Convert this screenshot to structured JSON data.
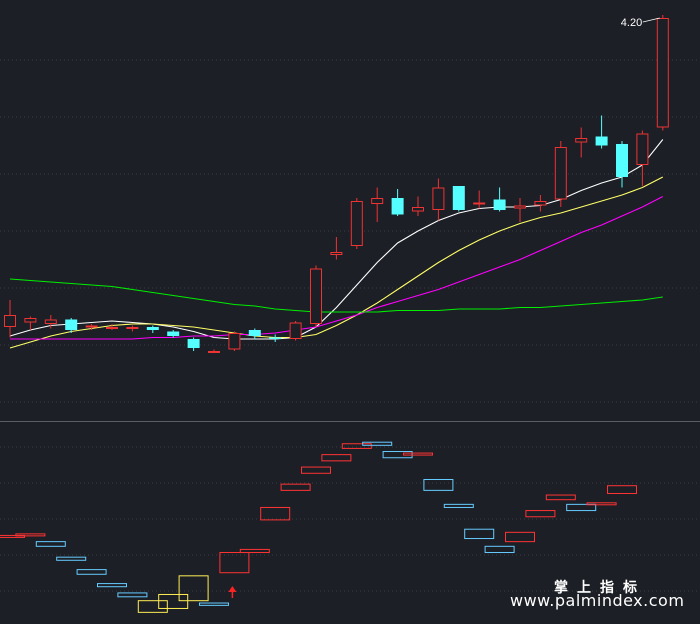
{
  "chart_data": {
    "type": "candlestick",
    "max_price_label": "4.20",
    "price_ylim": [
      1.5,
      4.3
    ],
    "candles": [
      {
        "o": 2.12,
        "h": 2.3,
        "l": 2.05,
        "c": 2.2
      },
      {
        "o": 2.15,
        "h": 2.19,
        "l": 2.1,
        "c": 2.18
      },
      {
        "o": 2.14,
        "h": 2.2,
        "l": 2.11,
        "c": 2.17
      },
      {
        "o": 2.17,
        "h": 2.18,
        "l": 2.08,
        "c": 2.1
      },
      {
        "o": 2.12,
        "h": 2.14,
        "l": 2.1,
        "c": 2.13
      },
      {
        "o": 2.12,
        "h": 2.14,
        "l": 2.1,
        "c": 2.12
      },
      {
        "o": 2.11,
        "h": 2.13,
        "l": 2.09,
        "c": 2.12
      },
      {
        "o": 2.12,
        "h": 2.13,
        "l": 2.08,
        "c": 2.1
      },
      {
        "o": 2.09,
        "h": 2.1,
        "l": 2.05,
        "c": 2.06
      },
      {
        "o": 2.04,
        "h": 2.05,
        "l": 1.96,
        "c": 1.98
      },
      {
        "o": 1.96,
        "h": 1.97,
        "l": 1.95,
        "c": 1.96
      },
      {
        "o": 1.97,
        "h": 2.09,
        "l": 1.96,
        "c": 2.08
      },
      {
        "o": 2.1,
        "h": 2.11,
        "l": 2.04,
        "c": 2.06
      },
      {
        "o": 2.05,
        "h": 2.07,
        "l": 2.02,
        "c": 2.04
      },
      {
        "o": 2.04,
        "h": 2.16,
        "l": 2.03,
        "c": 2.15
      },
      {
        "o": 2.14,
        "h": 2.53,
        "l": 2.12,
        "c": 2.51
      },
      {
        "o": 2.6,
        "h": 2.72,
        "l": 2.57,
        "c": 2.62
      },
      {
        "o": 2.66,
        "h": 2.98,
        "l": 2.64,
        "c": 2.96
      },
      {
        "o": 2.94,
        "h": 3.05,
        "l": 2.82,
        "c": 2.98
      },
      {
        "o": 2.98,
        "h": 3.04,
        "l": 2.86,
        "c": 2.87
      },
      {
        "o": 2.89,
        "h": 2.99,
        "l": 2.86,
        "c": 2.92
      },
      {
        "o": 2.9,
        "h": 3.11,
        "l": 2.83,
        "c": 3.05
      },
      {
        "o": 3.06,
        "h": 3.06,
        "l": 2.89,
        "c": 2.9
      },
      {
        "o": 2.94,
        "h": 3.03,
        "l": 2.91,
        "c": 2.95
      },
      {
        "o": 2.97,
        "h": 3.05,
        "l": 2.89,
        "c": 2.9
      },
      {
        "o": 2.91,
        "h": 2.98,
        "l": 2.82,
        "c": 2.93
      },
      {
        "o": 2.93,
        "h": 3.0,
        "l": 2.89,
        "c": 2.96
      },
      {
        "o": 2.97,
        "h": 3.36,
        "l": 2.92,
        "c": 3.32
      },
      {
        "o": 3.35,
        "h": 3.45,
        "l": 3.25,
        "c": 3.38
      },
      {
        "o": 3.39,
        "h": 3.53,
        "l": 3.31,
        "c": 3.33
      },
      {
        "o": 3.34,
        "h": 3.36,
        "l": 3.05,
        "c": 3.12
      },
      {
        "o": 3.2,
        "h": 3.43,
        "l": 3.06,
        "c": 3.41
      },
      {
        "o": 3.45,
        "h": 4.2,
        "l": 3.43,
        "c": 4.18
      }
    ],
    "ma_series": [
      {
        "color": "#ffffff",
        "values": [
          2.06,
          2.1,
          2.13,
          2.14,
          2.15,
          2.16,
          2.15,
          2.14,
          2.12,
          2.09,
          2.05,
          2.04,
          2.04,
          2.04,
          2.05,
          2.12,
          2.25,
          2.4,
          2.55,
          2.68,
          2.76,
          2.83,
          2.88,
          2.91,
          2.92,
          2.92,
          2.93,
          2.97,
          3.03,
          3.08,
          3.12,
          3.2,
          3.37
        ]
      },
      {
        "color": "#ffff66",
        "values": [
          1.98,
          2.02,
          2.06,
          2.09,
          2.11,
          2.13,
          2.14,
          2.14,
          2.13,
          2.12,
          2.1,
          2.08,
          2.06,
          2.05,
          2.05,
          2.07,
          2.13,
          2.2,
          2.28,
          2.37,
          2.46,
          2.55,
          2.63,
          2.7,
          2.76,
          2.81,
          2.85,
          2.88,
          2.92,
          2.96,
          3.0,
          3.05,
          3.12
        ]
      },
      {
        "color": "#ff00ff",
        "values": [
          2.04,
          2.04,
          2.04,
          2.04,
          2.04,
          2.04,
          2.04,
          2.05,
          2.05,
          2.06,
          2.06,
          2.07,
          2.07,
          2.08,
          2.1,
          2.12,
          2.16,
          2.2,
          2.25,
          2.29,
          2.33,
          2.37,
          2.42,
          2.47,
          2.52,
          2.57,
          2.63,
          2.69,
          2.75,
          2.8,
          2.86,
          2.92,
          2.99
        ]
      },
      {
        "color": "#00ee00",
        "values": [
          2.44,
          2.43,
          2.42,
          2.41,
          2.4,
          2.39,
          2.37,
          2.35,
          2.33,
          2.31,
          2.29,
          2.27,
          2.26,
          2.24,
          2.23,
          2.22,
          2.22,
          2.22,
          2.22,
          2.23,
          2.23,
          2.23,
          2.24,
          2.24,
          2.24,
          2.25,
          2.25,
          2.26,
          2.27,
          2.28,
          2.29,
          2.3,
          2.32
        ]
      }
    ],
    "indicator_bricks": [
      {
        "lo": 1.72,
        "hi": 1.74,
        "color": "#ff3333"
      },
      {
        "lo": 1.75,
        "hi": 1.76,
        "color": "#ff3333"
      },
      {
        "lo": 1.6,
        "hi": 1.66,
        "color": "#66ccff"
      },
      {
        "lo": 1.42,
        "hi": 1.46,
        "color": "#66ccff"
      },
      {
        "lo": 1.24,
        "hi": 1.3,
        "color": "#66ccff"
      },
      {
        "lo": 1.08,
        "hi": 1.12,
        "color": "#66ccff"
      },
      {
        "lo": 0.95,
        "hi": 1.0,
        "color": "#66ccff"
      },
      {
        "lo": 0.75,
        "hi": 0.9,
        "color": "#ffee55"
      },
      {
        "lo": 0.8,
        "hi": 0.98,
        "color": "#ffee55"
      },
      {
        "lo": 0.9,
        "hi": 1.22,
        "color": "#ffee55"
      },
      {
        "lo": 0.84,
        "hi": 0.87,
        "color": "#66ccff"
      },
      {
        "lo": 1.26,
        "hi": 1.52,
        "color": "#ff3333"
      },
      {
        "lo": 1.52,
        "hi": 1.56,
        "color": "#ff3333"
      },
      {
        "lo": 1.94,
        "hi": 2.1,
        "color": "#ff3333"
      },
      {
        "lo": 2.32,
        "hi": 2.4,
        "color": "#ff3333"
      },
      {
        "lo": 2.54,
        "hi": 2.62,
        "color": "#ff3333"
      },
      {
        "lo": 2.7,
        "hi": 2.78,
        "color": "#ff3333"
      },
      {
        "lo": 2.86,
        "hi": 2.92,
        "color": "#ff3333"
      },
      {
        "lo": 2.9,
        "hi": 2.94,
        "color": "#66ccff"
      },
      {
        "lo": 2.74,
        "hi": 2.82,
        "color": "#66ccff"
      },
      {
        "lo": 2.78,
        "hi": 2.8,
        "color": "#ff3333"
      },
      {
        "lo": 2.32,
        "hi": 2.46,
        "color": "#66ccff"
      },
      {
        "lo": 2.1,
        "hi": 2.14,
        "color": "#66ccff"
      },
      {
        "lo": 1.7,
        "hi": 1.82,
        "color": "#66ccff"
      },
      {
        "lo": 1.52,
        "hi": 1.6,
        "color": "#66ccff"
      },
      {
        "lo": 1.66,
        "hi": 1.78,
        "color": "#ff3333"
      },
      {
        "lo": 1.98,
        "hi": 2.06,
        "color": "#ff3333"
      },
      {
        "lo": 2.2,
        "hi": 2.26,
        "color": "#ff3333"
      },
      {
        "lo": 2.06,
        "hi": 2.14,
        "color": "#66ccff"
      },
      {
        "lo": 2.14,
        "hi": 2.16,
        "color": "#ff3333"
      },
      {
        "lo": 2.28,
        "hi": 2.38,
        "color": "#ff3333"
      }
    ],
    "indicator_ylim": [
      0.6,
      3.2
    ],
    "signal_arrow": {
      "index": 11,
      "color": "#ff2222"
    },
    "colors": {
      "up": "#ee3333",
      "down": "#55ffff",
      "background": "#1c1f26",
      "grid": "#3a3d45"
    },
    "grid": true
  },
  "watermark": {
    "line1": "掌上指标",
    "line2": "www.palmindex.com"
  }
}
